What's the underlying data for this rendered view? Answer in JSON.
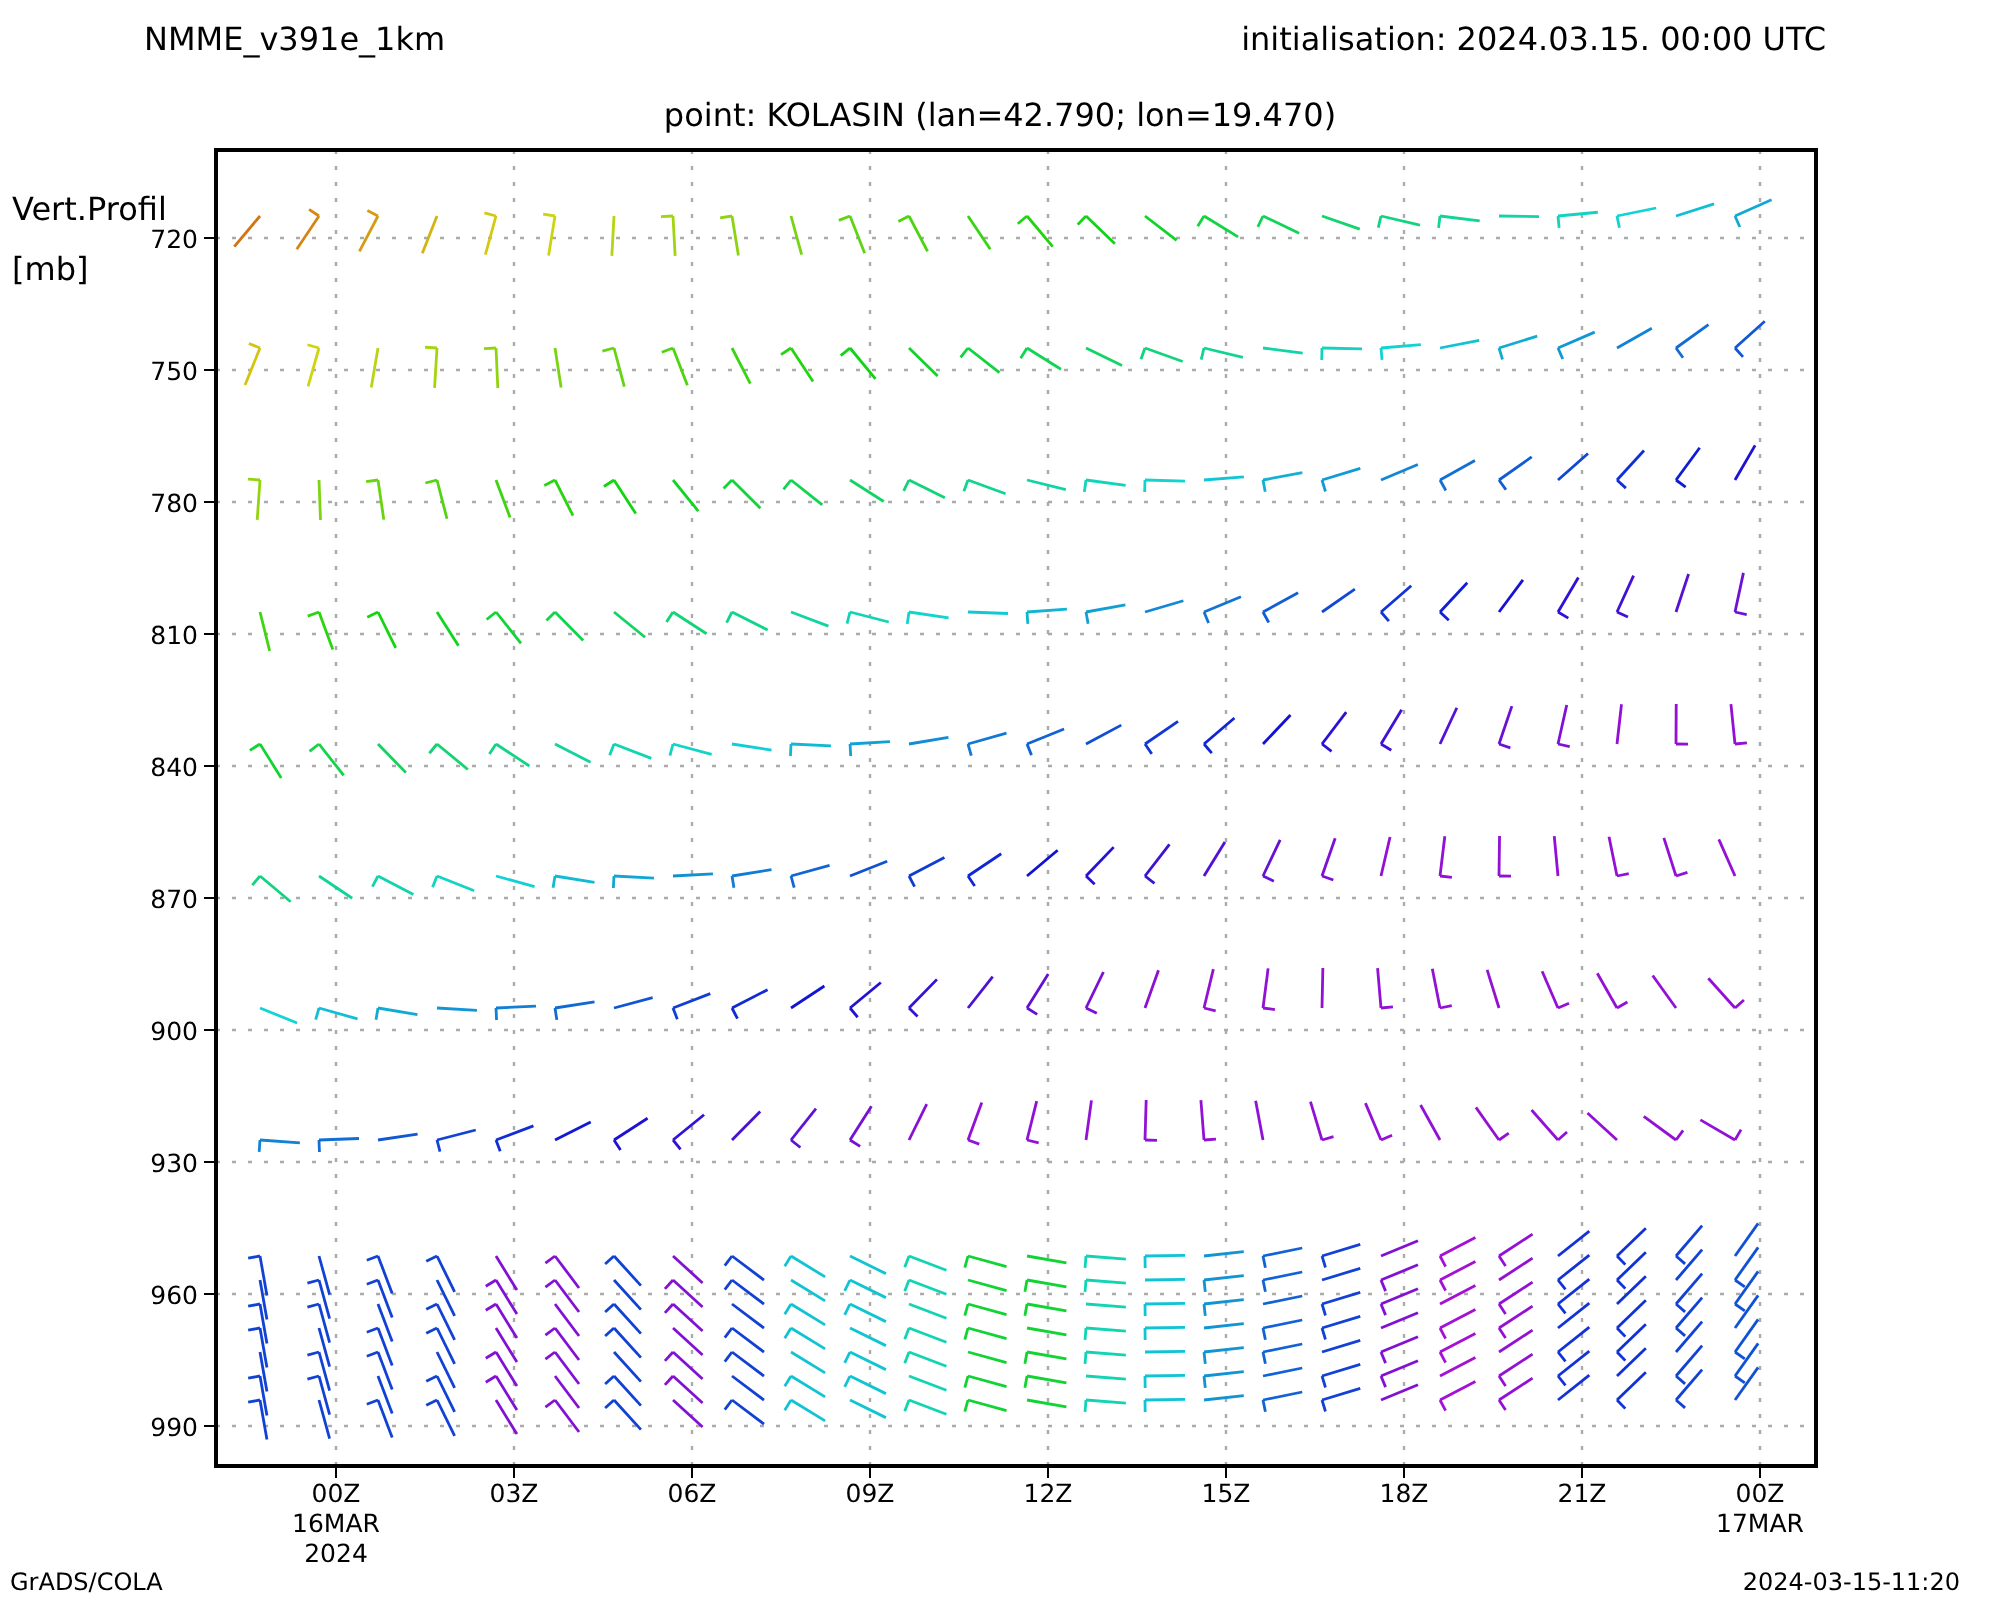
{
  "header": {
    "model": "NMME_v391e_1km",
    "initialisation": "initialisation: 2024.03.15. 00:00 UTC",
    "point": "point: KOLASIN (lan=42.790; lon=19.470)"
  },
  "y_axis": {
    "label_lines": [
      "Vert.Profil",
      "[mb]"
    ],
    "ticks": [
      "720",
      "750",
      "780",
      "810",
      "840",
      "870",
      "900",
      "930",
      "960",
      "990"
    ]
  },
  "x_axis": {
    "ticks": [
      {
        "lines": [
          "00Z",
          "16MAR",
          "2024"
        ]
      },
      {
        "lines": [
          "03Z"
        ]
      },
      {
        "lines": [
          "06Z"
        ]
      },
      {
        "lines": [
          "09Z"
        ]
      },
      {
        "lines": [
          "12Z"
        ]
      },
      {
        "lines": [
          "15Z"
        ]
      },
      {
        "lines": [
          "18Z"
        ]
      },
      {
        "lines": [
          "21Z"
        ]
      },
      {
        "lines": [
          "00Z",
          "17MAR"
        ]
      }
    ]
  },
  "footer": {
    "left": "GrADS/COLA",
    "right": "2024-03-15-11:20"
  }
}
